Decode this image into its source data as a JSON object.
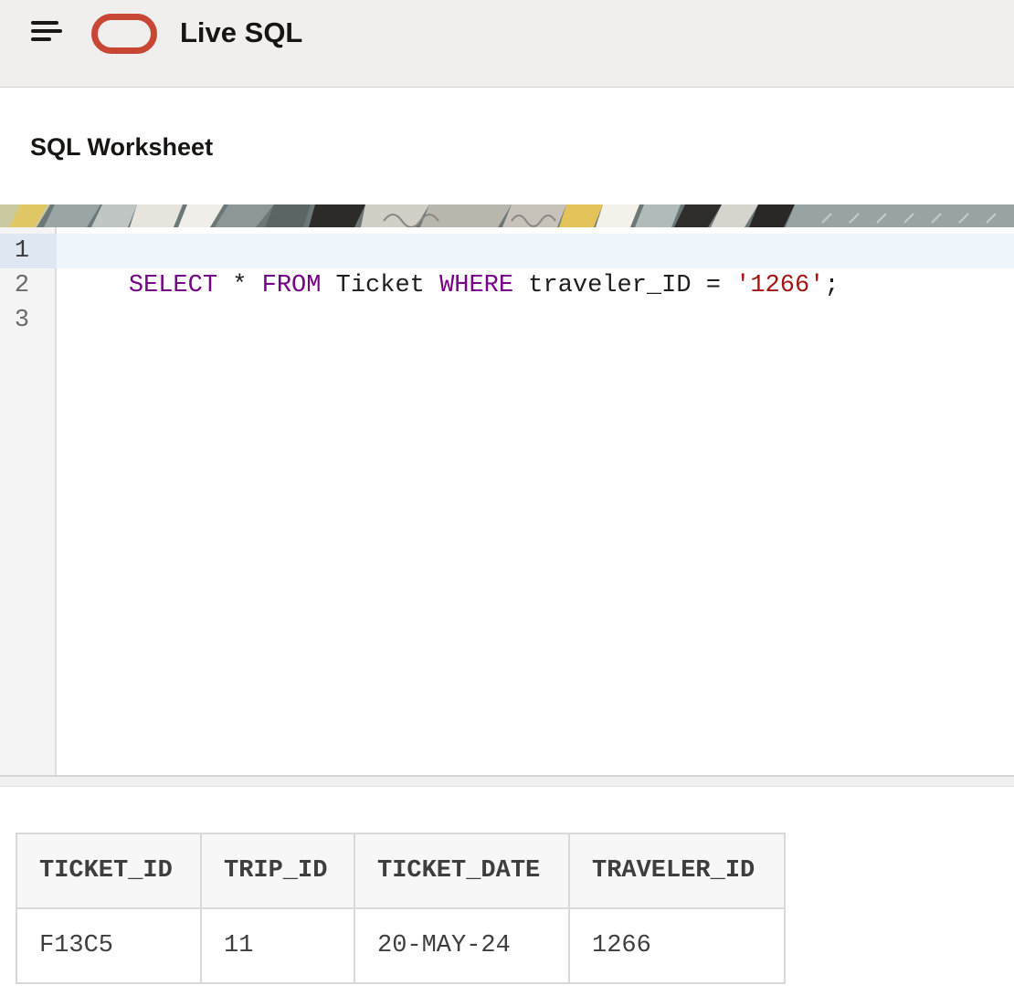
{
  "header": {
    "app_title": "Live SQL",
    "menu_icon": "hamburger-menu-icon",
    "logo_icon": "oracle-logo-icon",
    "logo_color": "#c74634"
  },
  "worksheet": {
    "title": "SQL Worksheet"
  },
  "editor": {
    "line_numbers": [
      "1",
      "2",
      "3"
    ],
    "lines": [
      {
        "tokens": [
          {
            "text": "SELECT",
            "type": "kw"
          },
          {
            "text": " * ",
            "type": "pl"
          },
          {
            "text": "FROM",
            "type": "kw"
          },
          {
            "text": " Ticket ",
            "type": "pl"
          },
          {
            "text": "WHERE",
            "type": "kw"
          },
          {
            "text": " traveler_ID = ",
            "type": "pl"
          },
          {
            "text": "'1266'",
            "type": "str"
          },
          {
            "text": ";",
            "type": "pl"
          }
        ]
      },
      {
        "tokens": []
      },
      {
        "tokens": []
      }
    ],
    "keyword_color": "#770088",
    "string_color": "#a31515"
  },
  "results": {
    "columns": [
      "TICKET_ID",
      "TRIP_ID",
      "TICKET_DATE",
      "TRAVELER_ID"
    ],
    "rows": [
      [
        "F13C5",
        "11",
        "20-MAY-24",
        "1266"
      ]
    ]
  }
}
